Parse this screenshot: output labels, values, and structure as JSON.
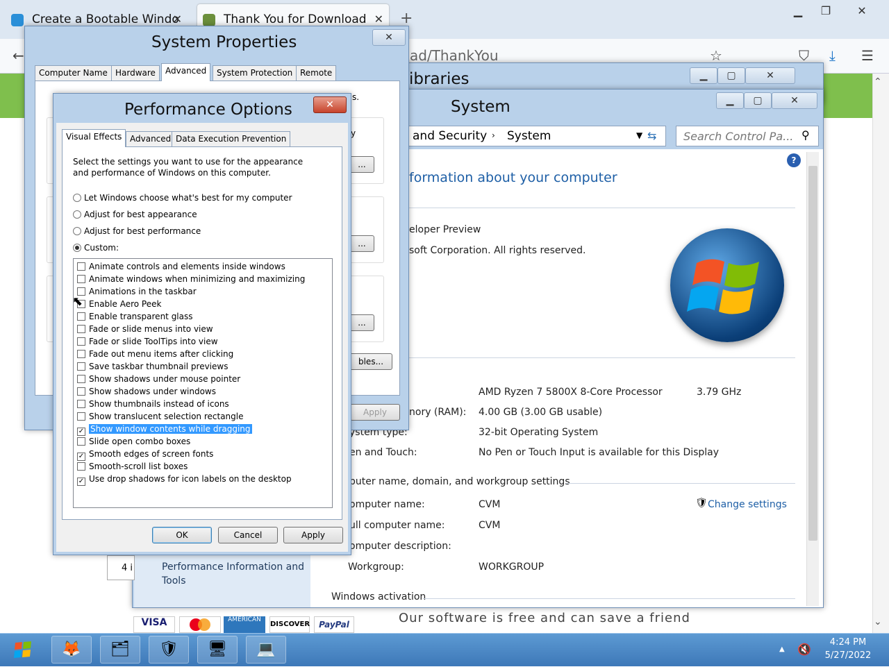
{
  "browser": {
    "tabs": [
      {
        "label": "Create a Bootable Windo"
      },
      {
        "label": "Thank You for Download"
      }
    ],
    "url_fragment": "ad/ThankYou",
    "page_bottom_text": "Our software is free and can save a friend",
    "payment_logos": [
      "VISA",
      "",
      "AMERICAN",
      "DISCOVER",
      "PayPal"
    ]
  },
  "libraries_window": {
    "title": "ibraries"
  },
  "system_window": {
    "title": "System",
    "breadcrumb": [
      "and Security",
      "System"
    ],
    "search_placeholder": "Search Control Pa...",
    "heading": "formation about your computer",
    "edition_lines": [
      "eloper Preview",
      "soft Corporation. All rights reserved."
    ],
    "specs": [
      {
        "label": "",
        "value": "AMD Ryzen 7 5800X 8-Core Processor",
        "extra": "3.79 GHz"
      },
      {
        "label": "nory (RAM):",
        "value": "4.00 GB (3.00 GB usable)"
      },
      {
        "label": "ystem type:",
        "value": "32-bit Operating System"
      },
      {
        "label": "en and Touch:",
        "value": "No Pen or Touch Input is available for this Display"
      }
    ],
    "computer_section": "puter name, domain, and workgroup settings",
    "computer_rows": [
      {
        "label": "omputer name:",
        "value": "CVM"
      },
      {
        "label": "ull computer name:",
        "value": "CVM"
      },
      {
        "label": "omputer description:",
        "value": ""
      },
      {
        "label": "Workgroup:",
        "value": "WORKGROUP"
      }
    ],
    "change_settings": "Change settings",
    "activation": "Windows activation",
    "sidebar_link": "Performance Information and Tools",
    "sidebar_partial": "4 i"
  },
  "system_properties": {
    "title": "System Properties",
    "tabs": [
      "Computer Name",
      "Hardware",
      "Advanced",
      "System Protection",
      "Remote"
    ],
    "button_partials": [
      "...",
      "...",
      "...",
      "bles..."
    ],
    "apply": "Apply",
    "snippet_a": "s.",
    "snippet_b": "y"
  },
  "performance_options": {
    "title": "Performance Options",
    "tabs": [
      "Visual Effects",
      "Advanced",
      "Data Execution Prevention"
    ],
    "description": "Select the settings you want to use for the appearance and performance of Windows on this computer.",
    "radios": [
      {
        "label": "Let Windows choose what's best for my computer",
        "checked": false
      },
      {
        "label": "Adjust for best appearance",
        "checked": false
      },
      {
        "label": "Adjust for best performance",
        "checked": false
      },
      {
        "label": "Custom:",
        "checked": true
      }
    ],
    "effects": [
      {
        "label": "Animate controls and elements inside windows",
        "checked": false
      },
      {
        "label": "Animate windows when minimizing and maximizing",
        "checked": false
      },
      {
        "label": "Animations in the taskbar",
        "checked": false
      },
      {
        "label": "Enable Aero Peek",
        "checked": false
      },
      {
        "label": "Enable transparent glass",
        "checked": false
      },
      {
        "label": "Fade or slide menus into view",
        "checked": false
      },
      {
        "label": "Fade or slide ToolTips into view",
        "checked": false
      },
      {
        "label": "Fade out menu items after clicking",
        "checked": false
      },
      {
        "label": "Save taskbar thumbnail previews",
        "checked": false
      },
      {
        "label": "Show shadows under mouse pointer",
        "checked": false
      },
      {
        "label": "Show shadows under windows",
        "checked": false
      },
      {
        "label": "Show thumbnails instead of icons",
        "checked": false
      },
      {
        "label": "Show translucent selection rectangle",
        "checked": false
      },
      {
        "label": "Show window contents while dragging",
        "checked": true,
        "selected": true
      },
      {
        "label": "Slide open combo boxes",
        "checked": false
      },
      {
        "label": "Smooth edges of screen fonts",
        "checked": true
      },
      {
        "label": "Smooth-scroll list boxes",
        "checked": false
      },
      {
        "label": "Use drop shadows for icon labels on the desktop",
        "checked": true
      }
    ],
    "ok": "OK",
    "cancel": "Cancel",
    "apply": "Apply"
  },
  "taskbar": {
    "time": "4:24 PM",
    "date": "5/27/2022"
  },
  "colors": {
    "accent": "#3399ff",
    "link": "#1e5fa6",
    "taskbar": "#4a86c4"
  }
}
